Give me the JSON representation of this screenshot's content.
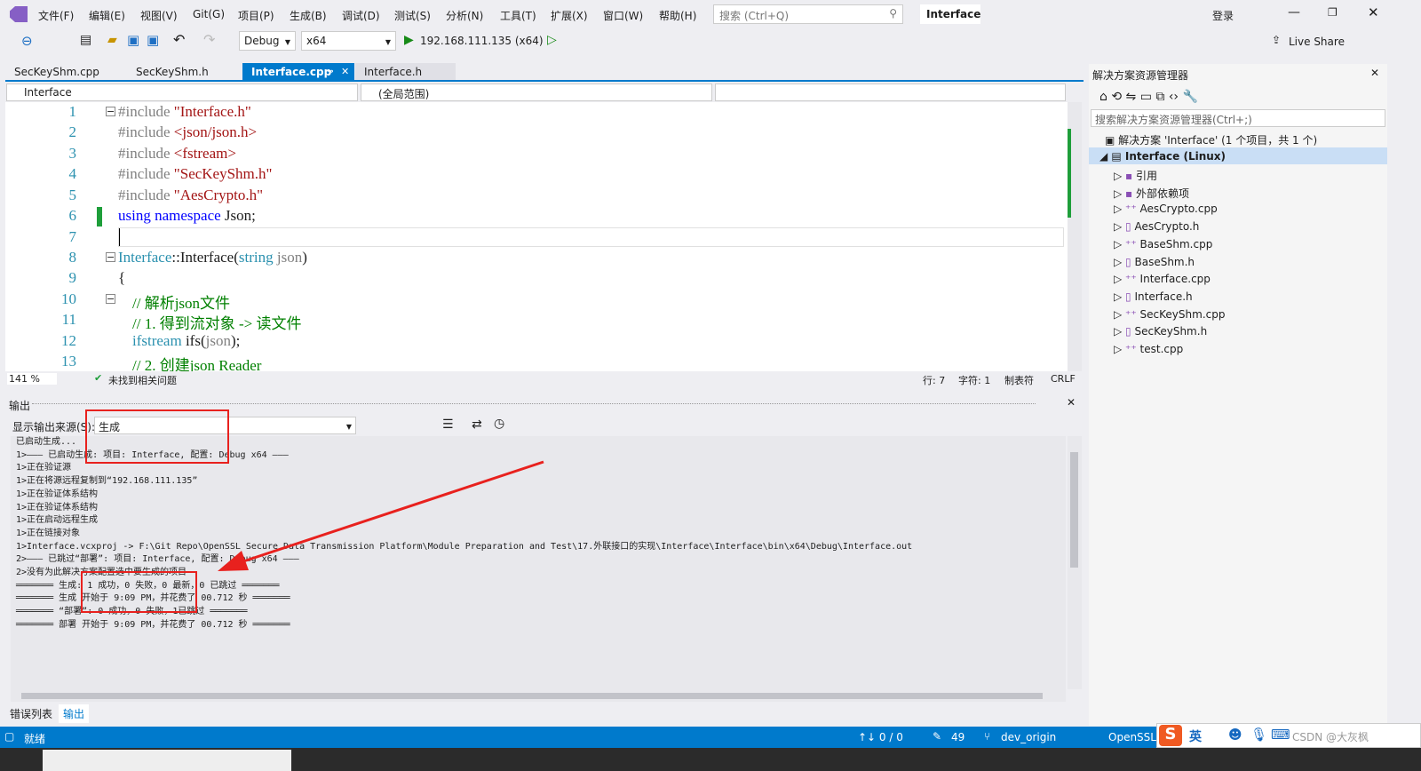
{
  "menubar": {
    "items": [
      "文件(F)",
      "编辑(E)",
      "视图(V)",
      "Git(G)",
      "项目(P)",
      "生成(B)",
      "调试(D)",
      "测试(S)",
      "分析(N)",
      "工具(T)",
      "扩展(X)",
      "窗口(W)",
      "帮助(H)"
    ],
    "search_placeholder": "搜索 (Ctrl+Q)",
    "window_title": "Interface",
    "login": "登录"
  },
  "toolbar": {
    "config": "Debug",
    "platform": "x64",
    "run_target": "192.168.111.135 (x64)",
    "live_share": "Live Share"
  },
  "tabs": [
    {
      "label": "SecKeyShm.cpp"
    },
    {
      "label": "SecKeyShm.h"
    },
    {
      "label": "Interface.cpp",
      "active": true
    },
    {
      "label": "Interface.h"
    }
  ],
  "nav": {
    "project": "Interface",
    "scope": "(全局范围)"
  },
  "editor": {
    "lines": [
      "1",
      "2",
      "3",
      "4",
      "5",
      "6",
      "7",
      "8",
      "9",
      "10",
      "11",
      "12",
      "13"
    ],
    "code": {
      "l1a": "#include ",
      "l1b": "\"Interface.h\"",
      "l2a": "#include ",
      "l2b": "<json/json.h>",
      "l3a": "#include ",
      "l3b": "<fstream>",
      "l4a": "#include ",
      "l4b": "\"SecKeyShm.h\"",
      "l5a": "#include ",
      "l5b": "\"AesCrypto.h\"",
      "l6a": "using namespace ",
      "l6b": "Json;",
      "l8a": "Interface",
      "l8b": "::Interface(",
      "l8c": "string ",
      "l8d": "json",
      ")": ")",
      "l9": "{",
      "l10": "// 解析json文件",
      "l11": "// 1. 得到流对象 -> 读文件",
      "l12a": "ifstream ",
      "l12b": "ifs(",
      "l12c": "json",
      "l12d": ");",
      "l13": "// 2. 创建json Reader"
    }
  },
  "edstatus": {
    "zoom": "141 %",
    "issues": "未找到相关问题",
    "line": "行: 7",
    "char": "字符: 1",
    "tab": "制表符",
    "eol": "CRLF"
  },
  "output": {
    "title": "输出",
    "source_label": "显示输出来源(S):",
    "source": "生成",
    "lines": [
      "已启动生成...",
      "1>——— 已启动生成: 项目: Interface, 配置: Debug x64 ———",
      "1>正在验证源",
      "1>正在将源远程复制到“192.168.111.135”",
      "1>正在验证体系结构",
      "1>正在验证体系结构",
      "1>正在启动远程生成",
      "1>正在链接对象",
      "1>Interface.vcxproj -> F:\\Git Repo\\OpenSSL Secure Data Transmission Platform\\Module Preparation and Test\\17.外联接口的实现\\Interface\\Interface\\bin\\x64\\Debug\\Interface.out",
      "2>——— 已跳过“部署”: 项目: Interface, 配置: Debug x64 ———",
      "2>没有为此解决方案配置选中要生成的项目",
      "═══════ 生成: 1 成功，0 失败，0 最新，0 已跳过 ═══════",
      "═══════ 生成 开始于 9:09 PM，并花费了 00.712 秒 ═══════",
      "═══════ “部署”: 0 成功，0 失败，1已跳过 ═══════",
      "═══════ 部署 开始于 9:09 PM，并花费了 00.712 秒 ═══════"
    ]
  },
  "bottom_tabs": [
    "错误列表",
    "输出"
  ],
  "solution": {
    "title": "解决方案资源管理器",
    "search_placeholder": "搜索解决方案资源管理器(Ctrl+;)",
    "root": "解决方案 'Interface' (1 个项目，共 1 个)",
    "project": "Interface (Linux)",
    "items": [
      "引用",
      "外部依赖项",
      "AesCrypto.cpp",
      "AesCrypto.h",
      "BaseShm.cpp",
      "BaseShm.h",
      "Interface.cpp",
      "Interface.h",
      "SecKeyShm.cpp",
      "SecKeyShm.h",
      "test.cpp"
    ]
  },
  "statusbar": {
    "ready": "就绪",
    "updown": "↑↓ 0 / 0",
    "edits": "49",
    "branch": "dev_origin",
    "repo": "OpenSSL",
    "ime": "英"
  },
  "watermark": "CSDN @大灰枫",
  "colors": {
    "accent": "#007acc",
    "annotation": "#e8211e"
  }
}
